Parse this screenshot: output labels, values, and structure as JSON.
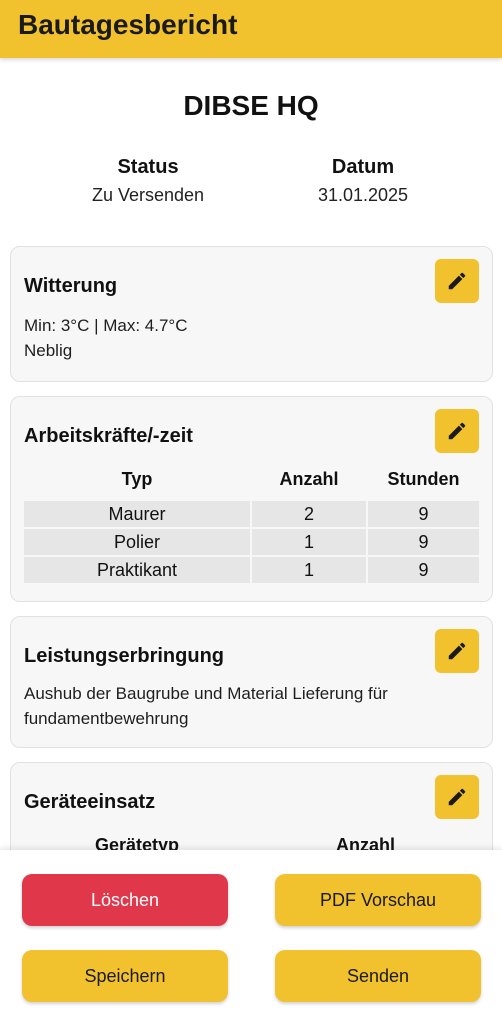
{
  "app_bar": {
    "title": "Bautagesbericht"
  },
  "header": {
    "site_name": "DIBSE HQ",
    "status_label": "Status",
    "status_value": "Zu Versenden",
    "date_label": "Datum",
    "date_value": "31.01.2025"
  },
  "weather": {
    "title": "Witterung",
    "temperature": "Min: 3°C | Max: 4.7°C",
    "condition": "Neblig"
  },
  "workforce": {
    "title": "Arbeitskräfte/-zeit",
    "columns": [
      "Typ",
      "Anzahl",
      "Stunden"
    ],
    "rows": [
      {
        "typ": "Maurer",
        "anzahl": "2",
        "stunden": "9"
      },
      {
        "typ": "Polier",
        "anzahl": "1",
        "stunden": "9"
      },
      {
        "typ": "Praktikant",
        "anzahl": "1",
        "stunden": "9"
      }
    ]
  },
  "performance": {
    "title": "Leistungserbringung",
    "text_line1": "Aushub der Baugrube und Material Lieferung für",
    "text_line2": "fundamentbewehrung"
  },
  "equipment": {
    "title": "Geräteeinsatz",
    "columns": [
      "Gerätetyp",
      "Anzahl"
    ]
  },
  "actions": {
    "delete_label": "Löschen",
    "pdf_preview_label": "PDF Vorschau",
    "save_label": "Speichern",
    "send_label": "Senden"
  },
  "colors": {
    "accent": "#f2c12e",
    "danger": "#e0384a",
    "card_background": "#f7f7f7"
  },
  "icons": {
    "edit": "pencil-icon"
  }
}
